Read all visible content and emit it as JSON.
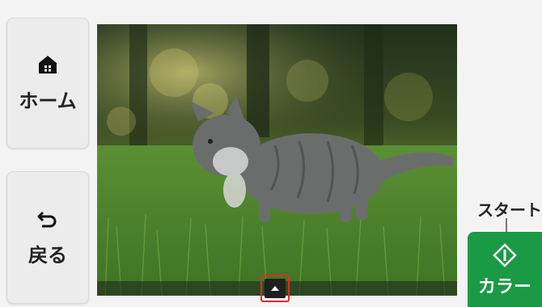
{
  "sidebar": {
    "home_label": "ホーム",
    "back_label": "戻る"
  },
  "preview": {
    "description_icon": "expand-up-icon"
  },
  "start": {
    "caption": "スタート",
    "button_label": "カラー"
  },
  "colors": {
    "start_green": "#1a9a45",
    "highlight_red": "#e12a2a"
  }
}
